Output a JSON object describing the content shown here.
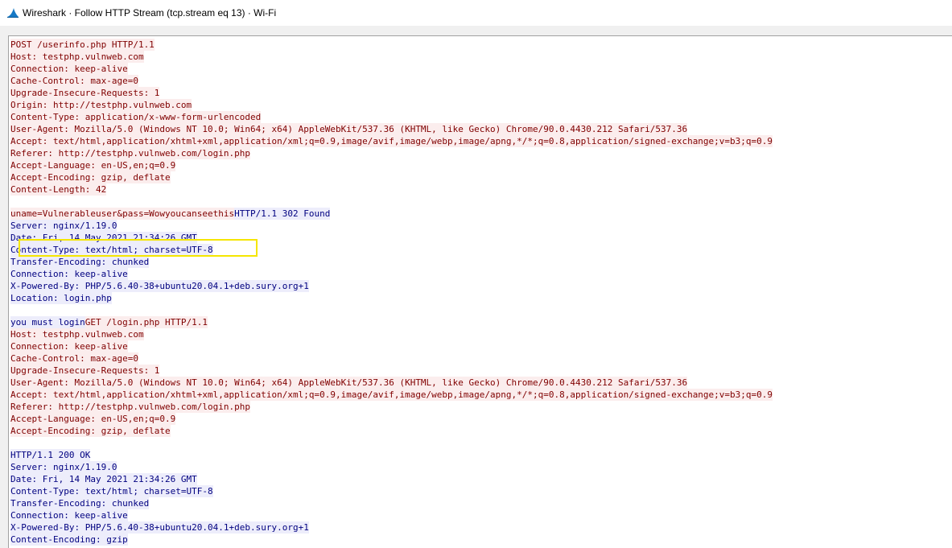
{
  "window": {
    "title": "Wireshark · Follow HTTP Stream (tcp.stream eq 13) · Wi-Fi",
    "icon": "wireshark-fin-icon",
    "colors": {
      "client_text": "#800000",
      "client_bg": "#fbeded",
      "server_text": "#000080",
      "server_bg": "#ededfb",
      "highlight_border": "#f5e600"
    }
  },
  "stream": {
    "lines": [
      [
        {
          "text": "POST /userinfo.php HTTP/1.1",
          "dir": "client"
        }
      ],
      [
        {
          "text": "Host: testphp.vulnweb.com",
          "dir": "client"
        }
      ],
      [
        {
          "text": "Connection: keep-alive",
          "dir": "client"
        }
      ],
      [
        {
          "text": "Cache-Control: max-age=0",
          "dir": "client"
        }
      ],
      [
        {
          "text": "Upgrade-Insecure-Requests: 1",
          "dir": "client"
        }
      ],
      [
        {
          "text": "Origin: http://testphp.vulnweb.com",
          "dir": "client"
        }
      ],
      [
        {
          "text": "Content-Type: application/x-www-form-urlencoded",
          "dir": "client"
        }
      ],
      [
        {
          "text": "User-Agent: Mozilla/5.0 (Windows NT 10.0; Win64; x64) AppleWebKit/537.36 (KHTML, like Gecko) Chrome/90.0.4430.212 Safari/537.36",
          "dir": "client"
        }
      ],
      [
        {
          "text": "Accept: text/html,application/xhtml+xml,application/xml;q=0.9,image/avif,image/webp,image/apng,*/*;q=0.8,application/signed-exchange;v=b3;q=0.9",
          "dir": "client"
        }
      ],
      [
        {
          "text": "Referer: http://testphp.vulnweb.com/login.php",
          "dir": "client"
        }
      ],
      [
        {
          "text": "Accept-Language: en-US,en;q=0.9",
          "dir": "client"
        }
      ],
      [
        {
          "text": "Accept-Encoding: gzip, deflate",
          "dir": "client"
        }
      ],
      [
        {
          "text": "Content-Length: 42",
          "dir": "client"
        }
      ],
      [],
      [
        {
          "text": "uname=Vulnerableuser&pass=Wowyoucanseethis",
          "dir": "client"
        },
        {
          "text": "HTTP/1.1 302 Found",
          "dir": "server"
        }
      ],
      [
        {
          "text": "Server: nginx/1.19.0",
          "dir": "server"
        }
      ],
      [
        {
          "text": "Date: Fri, 14 May 2021 21:34:26 GMT",
          "dir": "server"
        }
      ],
      [
        {
          "text": "Content-Type: text/html; charset=UTF-8",
          "dir": "server"
        }
      ],
      [
        {
          "text": "Transfer-Encoding: chunked",
          "dir": "server"
        }
      ],
      [
        {
          "text": "Connection: keep-alive",
          "dir": "server"
        }
      ],
      [
        {
          "text": "X-Powered-By: PHP/5.6.40-38+ubuntu20.04.1+deb.sury.org+1",
          "dir": "server"
        }
      ],
      [
        {
          "text": "Location: login.php",
          "dir": "server"
        }
      ],
      [],
      [
        {
          "text": "you must login",
          "dir": "server"
        },
        {
          "text": "GET /login.php HTTP/1.1",
          "dir": "client"
        }
      ],
      [
        {
          "text": "Host: testphp.vulnweb.com",
          "dir": "client"
        }
      ],
      [
        {
          "text": "Connection: keep-alive",
          "dir": "client"
        }
      ],
      [
        {
          "text": "Cache-Control: max-age=0",
          "dir": "client"
        }
      ],
      [
        {
          "text": "Upgrade-Insecure-Requests: 1",
          "dir": "client"
        }
      ],
      [
        {
          "text": "User-Agent: Mozilla/5.0 (Windows NT 10.0; Win64; x64) AppleWebKit/537.36 (KHTML, like Gecko) Chrome/90.0.4430.212 Safari/537.36",
          "dir": "client"
        }
      ],
      [
        {
          "text": "Accept: text/html,application/xhtml+xml,application/xml;q=0.9,image/avif,image/webp,image/apng,*/*;q=0.8,application/signed-exchange;v=b3;q=0.9",
          "dir": "client"
        }
      ],
      [
        {
          "text": "Referer: http://testphp.vulnweb.com/login.php",
          "dir": "client"
        }
      ],
      [
        {
          "text": "Accept-Language: en-US,en;q=0.9",
          "dir": "client"
        }
      ],
      [
        {
          "text": "Accept-Encoding: gzip, deflate",
          "dir": "client"
        }
      ],
      [],
      [
        {
          "text": "HTTP/1.1 200 OK",
          "dir": "server"
        }
      ],
      [
        {
          "text": "Server: nginx/1.19.0",
          "dir": "server"
        }
      ],
      [
        {
          "text": "Date: Fri, 14 May 2021 21:34:26 GMT",
          "dir": "server"
        }
      ],
      [
        {
          "text": "Content-Type: text/html; charset=UTF-8",
          "dir": "server"
        }
      ],
      [
        {
          "text": "Transfer-Encoding: chunked",
          "dir": "server"
        }
      ],
      [
        {
          "text": "Connection: keep-alive",
          "dir": "server"
        }
      ],
      [
        {
          "text": "X-Powered-By: PHP/5.6.40-38+ubuntu20.04.1+deb.sury.org+1",
          "dir": "server"
        }
      ],
      [
        {
          "text": "Content-Encoding: gzip",
          "dir": "server"
        }
      ]
    ]
  }
}
